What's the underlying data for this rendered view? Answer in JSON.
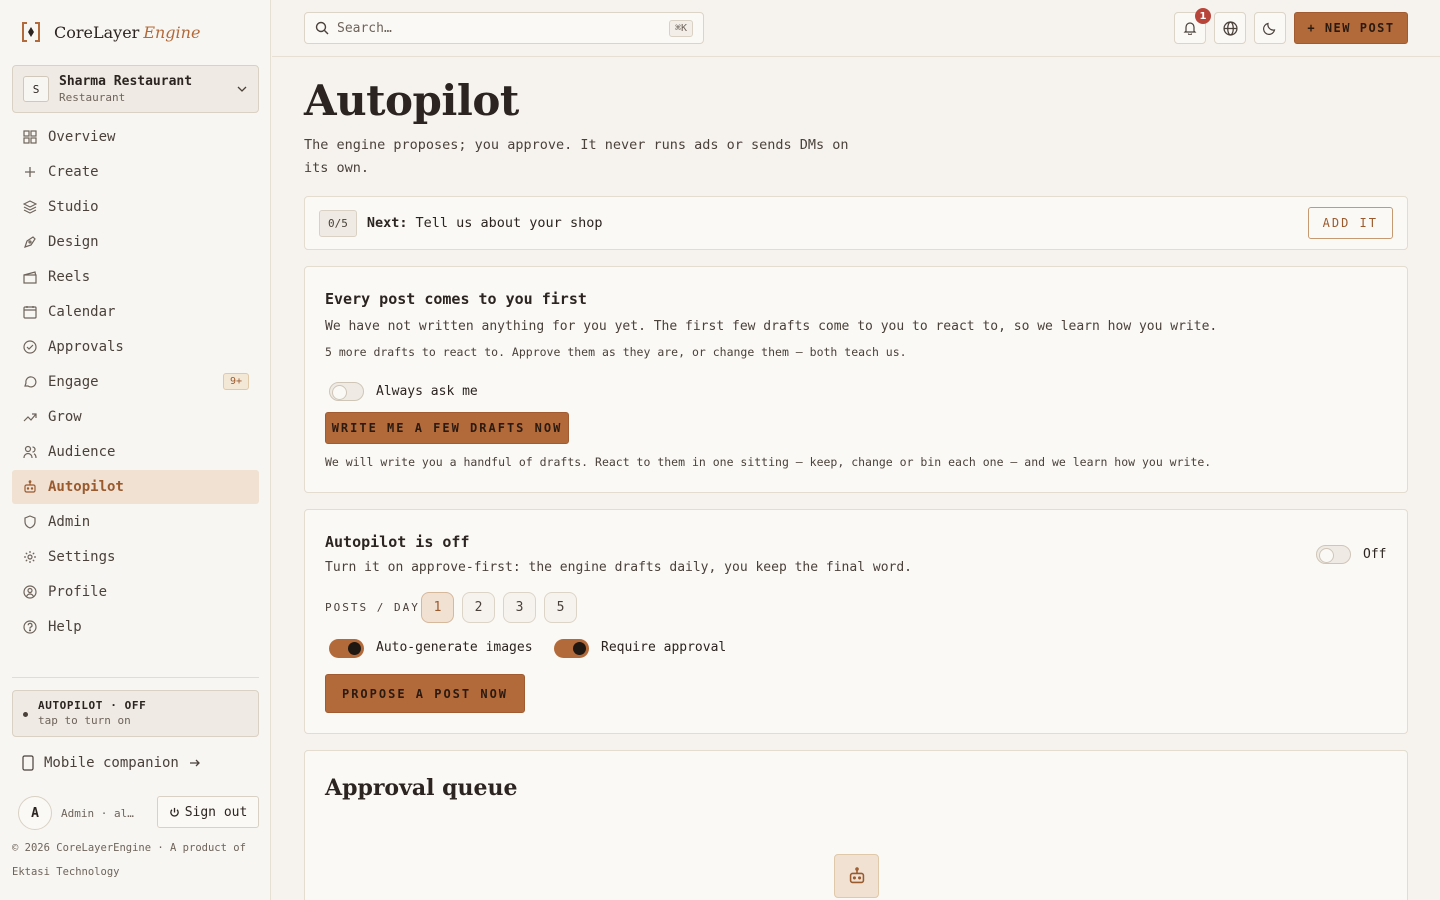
{
  "brand": {
    "name": "CoreLayer",
    "sub": "Engine"
  },
  "shop": {
    "initial": "S",
    "name": "Sharma Restaurant",
    "type": "Restaurant"
  },
  "nav": {
    "items": [
      {
        "label": "Overview",
        "icon": "grid-icon"
      },
      {
        "label": "Create",
        "icon": "plus-icon"
      },
      {
        "label": "Studio",
        "icon": "layers-icon"
      },
      {
        "label": "Design",
        "icon": "pen-tool-icon"
      },
      {
        "label": "Reels",
        "icon": "clapper-icon"
      },
      {
        "label": "Calendar",
        "icon": "calendar-icon"
      },
      {
        "label": "Approvals",
        "icon": "check-circle-icon"
      },
      {
        "label": "Engage",
        "icon": "chat-bubble-icon",
        "badge": "9+"
      },
      {
        "label": "Grow",
        "icon": "trending-up-icon"
      },
      {
        "label": "Audience",
        "icon": "users-icon"
      },
      {
        "label": "Autopilot",
        "icon": "bot-icon",
        "active": true
      },
      {
        "label": "Admin",
        "icon": "shield-icon"
      },
      {
        "label": "Settings",
        "icon": "gear-icon"
      },
      {
        "label": "Profile",
        "icon": "user-circle-icon"
      },
      {
        "label": "Help",
        "icon": "help-circle-icon"
      }
    ]
  },
  "autopilot_status": {
    "title": "AUTOPILOT · OFF",
    "sub": "tap to turn on"
  },
  "mobile_link": {
    "label": "Mobile companion"
  },
  "user": {
    "initial": "A",
    "label": "Admin · al…",
    "signout": "Sign out"
  },
  "footer": {
    "text": "© 2026 CoreLayerEngine · A product of Ektasi Technology"
  },
  "topbar": {
    "search_placeholder": "Search…",
    "search_shortcut": "⌘K",
    "notif_count": "1",
    "new_post": "+ NEW POST"
  },
  "page": {
    "title": "Autopilot",
    "subtitle": "The engine proposes; you approve. It never runs ads or sends DMs on its own."
  },
  "next_step": {
    "progress": "0/5",
    "label": "Next:",
    "text": "Tell us about your shop",
    "button": "ADD IT"
  },
  "first_card": {
    "title": "Every post comes to you first",
    "text": "We have not written anything for you yet. The first few drafts come to you to react to, so we learn how you write.",
    "small": "5 more drafts to react to. Approve them as they are, or change them — both teach us.",
    "toggle_label": "Always ask me",
    "toggle_on": false,
    "button": "WRITE ME A FEW DRAFTS NOW",
    "note": "We will write you a handful of drafts. React to them in one sitting — keep, change or bin each one — and we learn how you write."
  },
  "autopilot_card": {
    "title": "Autopilot is off",
    "text": "Turn it on approve-first: the engine drafts daily, you keep the final word.",
    "main_toggle_label": "Off",
    "main_toggle_on": false,
    "posts_per_day_label": "POSTS / DAY",
    "posts_per_day_options": [
      "1",
      "2",
      "3",
      "5"
    ],
    "posts_per_day_selected": "1",
    "auto_images_label": "Auto-generate images",
    "auto_images_on": true,
    "require_approval_label": "Require approval",
    "require_approval_on": true,
    "button": "PROPOSE A POST NOW"
  },
  "queue": {
    "title": "Approval queue",
    "empty_icon": "bot-icon"
  },
  "colors": {
    "accent": "#b36a3a",
    "active_bg": "#f0e1d3",
    "badge_red": "#b8453a",
    "page_bg": "#f6f3ee"
  }
}
